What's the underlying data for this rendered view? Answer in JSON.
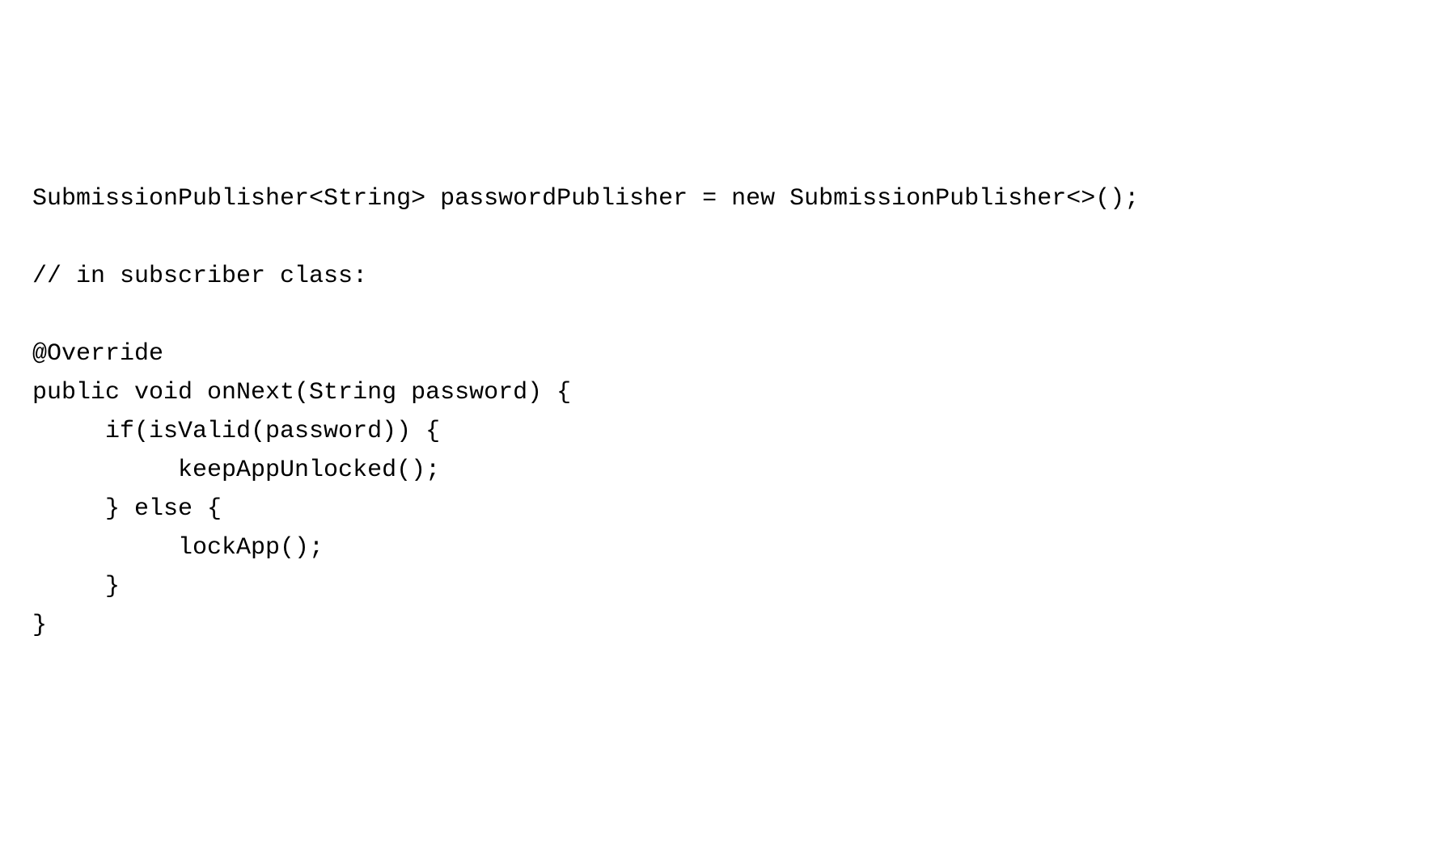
{
  "code": {
    "lines": [
      "SubmissionPublisher<String> passwordPublisher = new SubmissionPublisher<>();",
      "",
      "// in subscriber class:",
      "",
      "@Override",
      "public void onNext(String password) {",
      "     if(isValid(password)) {",
      "          keepAppUnlocked();",
      "     } else {",
      "          lockApp();",
      "     }",
      "}"
    ]
  }
}
